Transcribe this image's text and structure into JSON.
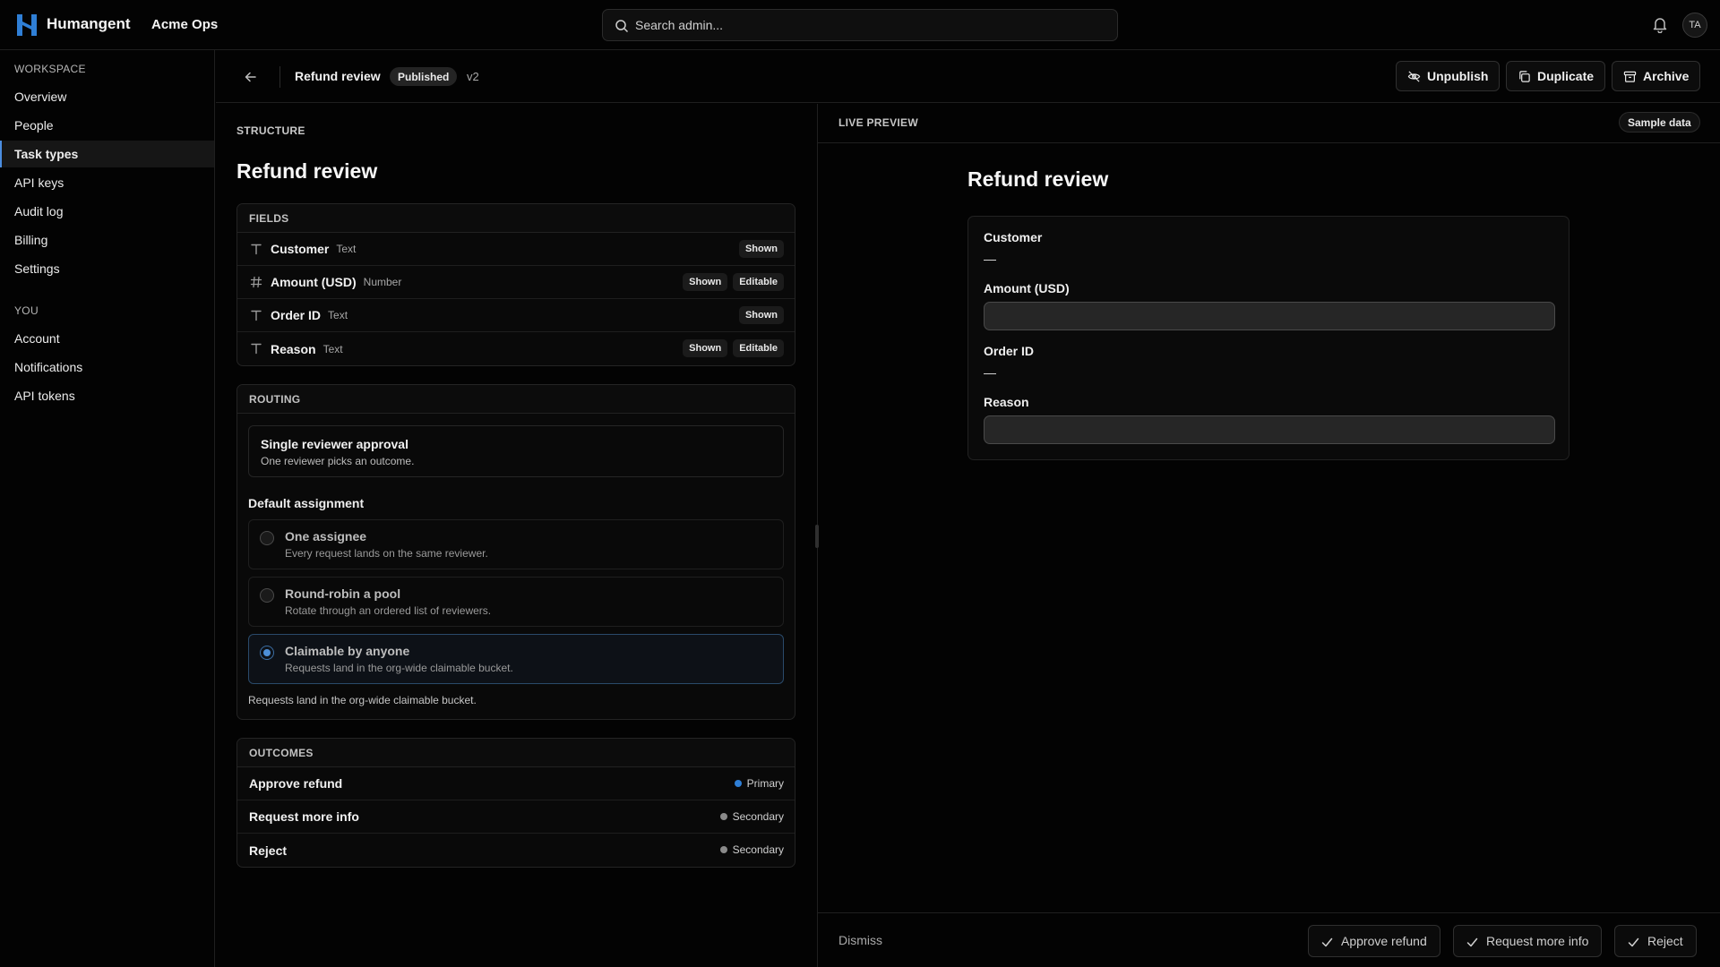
{
  "topbar": {
    "brand": "Humangent",
    "org": "Acme Ops",
    "search_placeholder": "Search admin...",
    "avatar_initials": "TA",
    "accent_color": "#2f7fd6"
  },
  "sidebar": {
    "workspace_label": "WORKSPACE",
    "workspace_items": [
      "Overview",
      "People",
      "Task types",
      "API keys",
      "Audit log",
      "Billing",
      "Settings"
    ],
    "active_item": "Task types",
    "you_label": "YOU",
    "you_items": [
      "Account",
      "Notifications",
      "API tokens"
    ]
  },
  "header": {
    "title": "Refund review",
    "status_badge": "Published",
    "version": "v2",
    "unpublish_label": "Unpublish",
    "duplicate_label": "Duplicate",
    "archive_label": "Archive"
  },
  "structure": {
    "section_label": "STRUCTURE",
    "title": "Refund review",
    "fields_label": "FIELDS",
    "fields": [
      {
        "name": "Customer",
        "type": "Text",
        "icon": "text-icon",
        "chips": [
          "Shown"
        ]
      },
      {
        "name": "Amount (USD)",
        "type": "Number",
        "icon": "number-icon",
        "chips": [
          "Shown",
          "Editable"
        ]
      },
      {
        "name": "Order ID",
        "type": "Text",
        "icon": "text-icon",
        "chips": [
          "Shown"
        ]
      },
      {
        "name": "Reason",
        "type": "Text",
        "icon": "text-icon",
        "chips": [
          "Shown",
          "Editable"
        ]
      }
    ],
    "routing_label": "ROUTING",
    "routing_mode_title": "Single reviewer approval",
    "routing_mode_desc": "One reviewer picks an outcome.",
    "default_assignment_label": "Default assignment",
    "assignment_options": [
      {
        "title": "One assignee",
        "desc": "Every request lands on the same reviewer.",
        "selected": false
      },
      {
        "title": "Round-robin a pool",
        "desc": "Rotate through an ordered list of reviewers.",
        "selected": false
      },
      {
        "title": "Claimable by anyone",
        "desc": "Requests land in the org-wide claimable bucket.",
        "selected": true
      }
    ],
    "routing_footnote": "Requests land in the org-wide claimable bucket.",
    "outcomes_label": "OUTCOMES",
    "outcomes": [
      {
        "name": "Approve refund",
        "tag": "Primary",
        "dot_color": "#2f7fd6"
      },
      {
        "name": "Request more info",
        "tag": "Secondary",
        "dot_color": "#8a8a8a"
      },
      {
        "name": "Reject",
        "tag": "Secondary",
        "dot_color": "#8a8a8a"
      }
    ]
  },
  "preview": {
    "section_label": "LIVE PREVIEW",
    "sample_data_label": "Sample data",
    "title": "Refund review",
    "fields": [
      {
        "label": "Customer",
        "kind": "readonly",
        "value": "—"
      },
      {
        "label": "Amount (USD)",
        "kind": "input",
        "value": ""
      },
      {
        "label": "Order ID",
        "kind": "readonly",
        "value": "—"
      },
      {
        "label": "Reason",
        "kind": "input",
        "value": ""
      }
    ],
    "dismiss_label": "Dismiss",
    "actions": [
      "Approve refund",
      "Request more info",
      "Reject"
    ]
  }
}
